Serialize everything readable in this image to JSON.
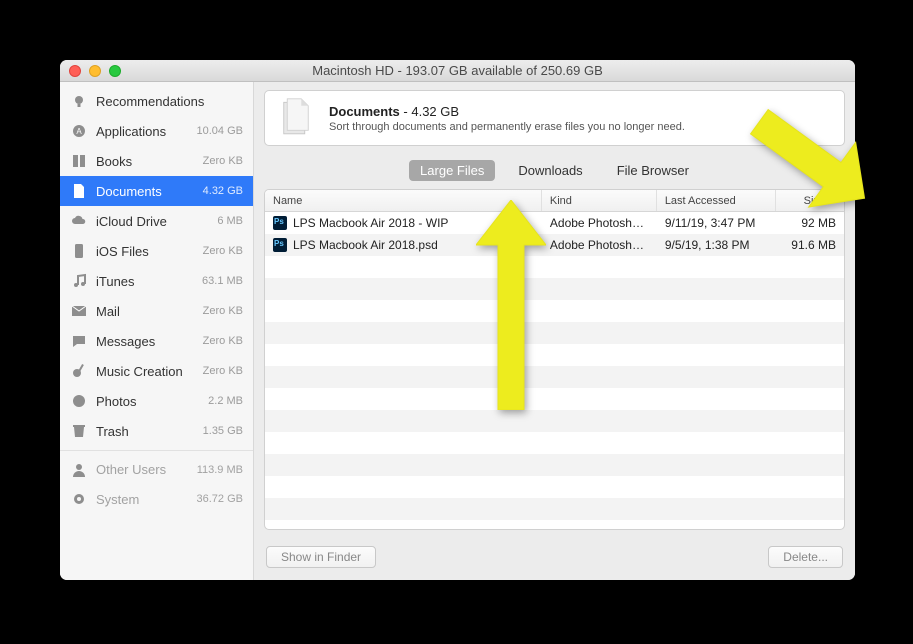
{
  "window_title": "Macintosh HD - 193.07 GB available of 250.69 GB",
  "header_title": "Documents",
  "header_size": " - 4.32 GB",
  "header_sub": "Sort through documents and permanently erase files you no longer need.",
  "tabs": [
    {
      "label": "Large Files",
      "active": true
    },
    {
      "label": "Downloads",
      "active": false
    },
    {
      "label": "File Browser",
      "active": false
    }
  ],
  "columns": {
    "name": "Name",
    "kind": "Kind",
    "last": "Last Accessed",
    "size": "Size"
  },
  "footer": {
    "show": "Show in Finder",
    "delete": "Delete..."
  },
  "sidebar": [
    {
      "icon": "lightbulb",
      "label": "Recommendations",
      "meta": ""
    },
    {
      "icon": "app",
      "label": "Applications",
      "meta": "10.04 GB"
    },
    {
      "icon": "book",
      "label": "Books",
      "meta": "Zero KB"
    },
    {
      "icon": "doc",
      "label": "Documents",
      "meta": "4.32 GB",
      "active": true
    },
    {
      "icon": "cloud",
      "label": "iCloud Drive",
      "meta": "6 MB"
    },
    {
      "icon": "phone",
      "label": "iOS Files",
      "meta": "Zero KB"
    },
    {
      "icon": "music",
      "label": "iTunes",
      "meta": "63.1 MB"
    },
    {
      "icon": "mail",
      "label": "Mail",
      "meta": "Zero KB"
    },
    {
      "icon": "chat",
      "label": "Messages",
      "meta": "Zero KB"
    },
    {
      "icon": "guitar",
      "label": "Music Creation",
      "meta": "Zero KB"
    },
    {
      "icon": "photos",
      "label": "Photos",
      "meta": "2.2 MB"
    },
    {
      "icon": "trash",
      "label": "Trash",
      "meta": "1.35 GB"
    },
    {
      "icon": "users",
      "label": "Other Users",
      "meta": "113.9 MB",
      "sep": true,
      "dim": true
    },
    {
      "icon": "gear",
      "label": "System",
      "meta": "36.72 GB",
      "dim": true
    }
  ],
  "files": [
    {
      "name": "LPS Macbook Air 2018 - WIP",
      "kind": "Adobe Photoshop...",
      "last": "9/11/19, 3:47 PM",
      "size": "92 MB"
    },
    {
      "name": "LPS Macbook Air 2018.psd",
      "kind": "Adobe Photoshop...",
      "last": "9/5/19, 1:38 PM",
      "size": "91.6 MB"
    }
  ]
}
